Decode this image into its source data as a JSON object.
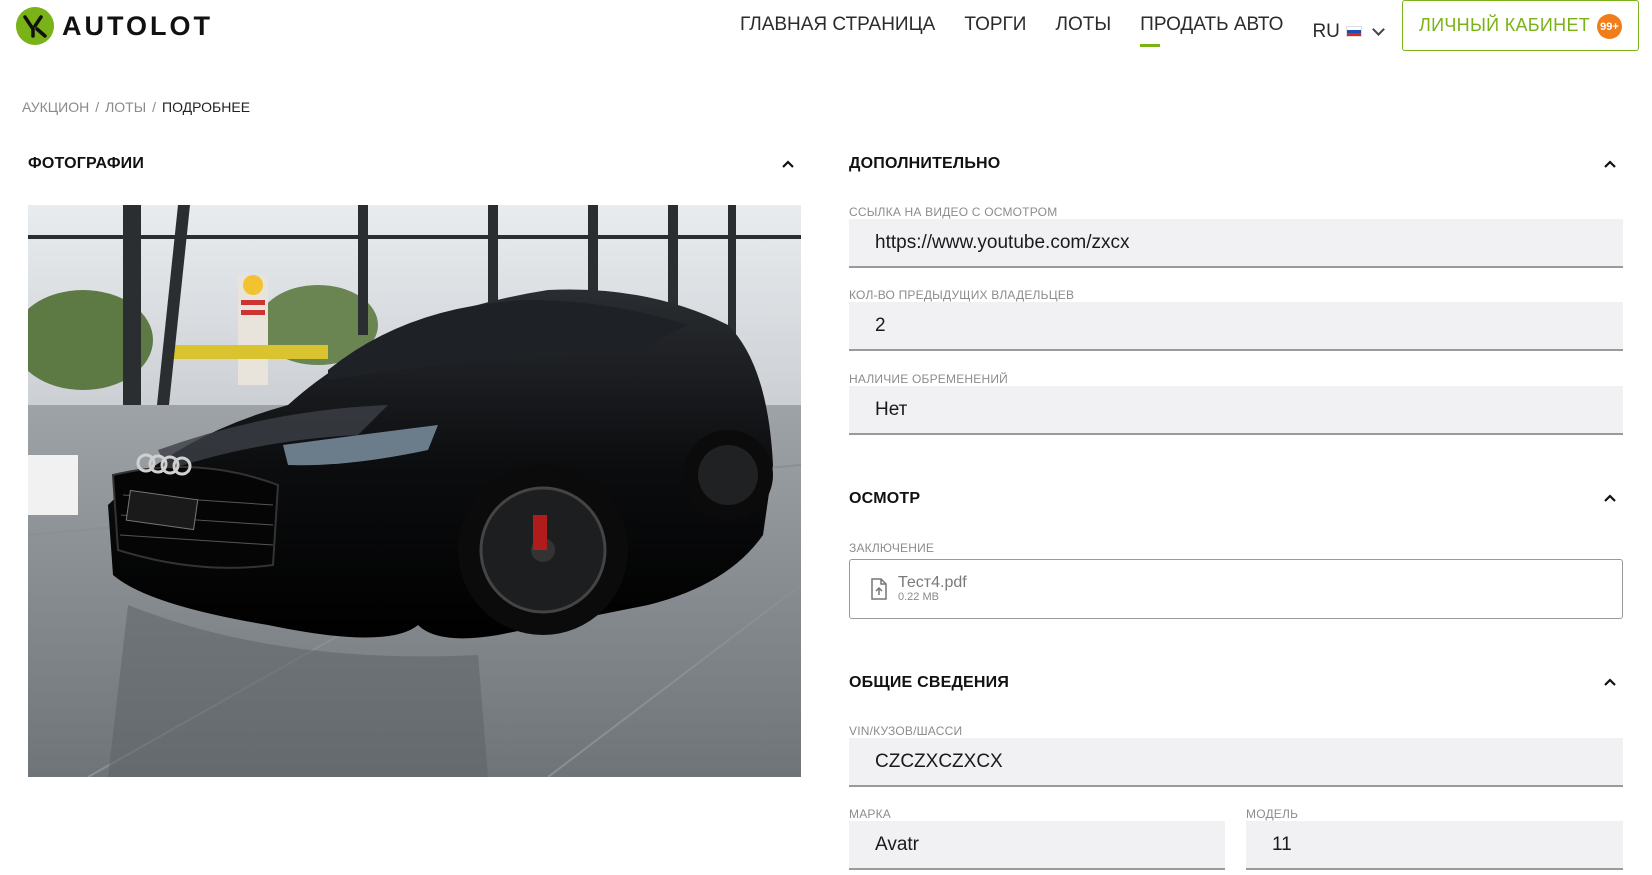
{
  "header": {
    "logo_text": "AUTOLOT",
    "nav": [
      {
        "label": "ГЛАВНАЯ СТРАНИЦА",
        "active": false
      },
      {
        "label": "ТОРГИ",
        "active": false
      },
      {
        "label": "ЛОТЫ",
        "active": false
      },
      {
        "label": "ПРОДАТЬ АВТО",
        "active": true
      }
    ],
    "language": "RU",
    "cabinet_label": "ЛИЧНЫЙ КАБИНЕТ",
    "badge_count": "99+",
    "accent_color": "#7ab317",
    "badge_color": "#f07d1a"
  },
  "breadcrumb": {
    "items": [
      "АУКЦИОН",
      "ЛОТЫ"
    ],
    "current": "ПОДРОБНЕЕ",
    "separator": "/"
  },
  "photos": {
    "title": "ФОТОГРАФИИ"
  },
  "additional": {
    "title": "ДОПОЛНИТЕЛЬНО",
    "video_label": "ССЫЛКА НА ВИДЕО С ОСМОТРОМ",
    "video_value": "https://www.youtube.com/zxcx",
    "owners_label": "КОЛ-ВО ПРЕДЫДУЩИХ ВЛАДЕЛЬЦЕВ",
    "owners_value": "2",
    "encumbrance_label": "НАЛИЧИЕ ОБРЕМЕНЕНИЙ",
    "encumbrance_value": "Нет"
  },
  "inspection": {
    "title": "ОСМОТР",
    "conclusion_label": "ЗАКЛЮЧЕНИЕ",
    "file_name": "Тест4.pdf",
    "file_size": "0.22 MB"
  },
  "general": {
    "title": "ОБЩИЕ СВЕДЕНИЯ",
    "vin_label": "VIN/КУЗОВ/ШАССИ",
    "vin_value": "CZCZXCZXCX",
    "brand_label": "МАРКА",
    "brand_value": "Avatr",
    "model_label": "МОДЕЛЬ",
    "model_value": "11"
  }
}
